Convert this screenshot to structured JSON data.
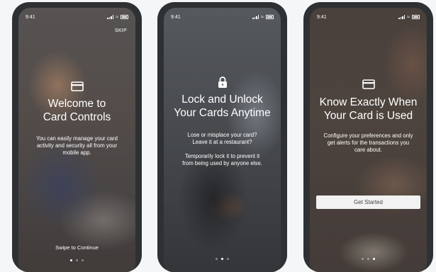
{
  "screens": [
    {
      "status_time": "9:41",
      "skip_label": "SKIP",
      "icon": "credit-card-icon",
      "title_line1": "Welcome to",
      "title_line2": "Card Controls",
      "body_line1": "You can easily manage your card",
      "body_line2": "activity and security all from your",
      "body_line3": "mobile app.",
      "swipe_label": "Swipe to Continue",
      "active_dot": 1
    },
    {
      "status_time": "9:41",
      "icon": "lock-icon",
      "title_line1": "Lock and Unlock",
      "title_line2": "Your Cards Anytime",
      "body_line1": "Lose or misplace your card?",
      "body_line2": "Leave it at a restaurant?",
      "body_line3": "Temporarily lock it to prevent it",
      "body_line4": "from being used by anyone else.",
      "active_dot": 2
    },
    {
      "status_time": "9:41",
      "icon": "credit-card-icon",
      "title_line1": "Know Exactly When",
      "title_line2": "Your Card is Used",
      "body_line1": "Configure your preferences and only",
      "body_line2": "get alerts for the transactions you",
      "body_line3": "care about.",
      "button_label": "Get Started",
      "active_dot": 3
    }
  ],
  "colors": {
    "bezel": "#2d3134",
    "background": "#f4f6f7",
    "button": "#f2f2f2"
  }
}
